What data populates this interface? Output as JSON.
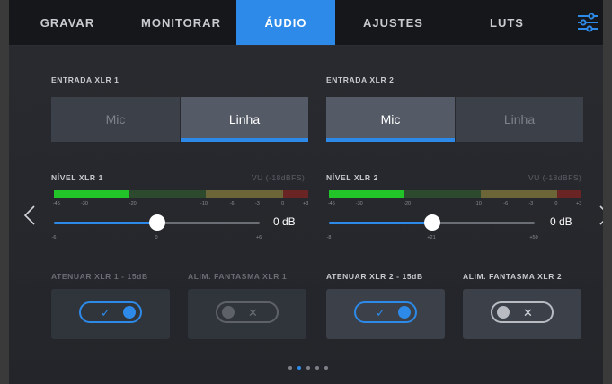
{
  "tabs": [
    {
      "label": "GRAVAR",
      "active": false
    },
    {
      "label": "MONITORAR",
      "active": false
    },
    {
      "label": "ÁUDIO",
      "active": true
    },
    {
      "label": "AJUSTES",
      "active": false
    },
    {
      "label": "LUTS",
      "active": false
    }
  ],
  "channel1": {
    "input_label": "ENTRADA XLR 1",
    "input_options": [
      "Mic",
      "Linha"
    ],
    "input_selected": "Linha",
    "level_label": "NÍVEL XLR 1",
    "vu_label": "VU (-18dBFS)",
    "meter_ticks": [
      "-45",
      "-30",
      "-20",
      "-10",
      "-6",
      "-3",
      "0",
      "+3"
    ],
    "gain_value": "0 dB",
    "gain_fraction": 0.5,
    "scale": [
      "-6",
      "0",
      "+6"
    ],
    "attenuate_label": "ATENUAR XLR 1 - 15dB",
    "attenuate_on": true,
    "phantom_label": "ALIM. FANTASMA XLR 1",
    "phantom_on": false
  },
  "channel2": {
    "input_label": "ENTRADA XLR 2",
    "input_options": [
      "Mic",
      "Linha"
    ],
    "input_selected": "Mic",
    "level_label": "NÍVEL XLR 2",
    "vu_label": "VU (-18dBFS)",
    "meter_ticks": [
      "-45",
      "-30",
      "-20",
      "-10",
      "-6",
      "-3",
      "0",
      "+3"
    ],
    "gain_value": "0 dB",
    "gain_fraction": 0.5,
    "scale": [
      "-8",
      "+21",
      "+50"
    ],
    "attenuate_label": "ATENUAR XLR 2 - 15dB",
    "attenuate_on": true,
    "phantom_label": "ALIM. FANTASMA XLR 2",
    "phantom_on": false
  },
  "toggle_marks": {
    "on": "✓",
    "off": "✕"
  },
  "pager": {
    "count": 5,
    "active": 1
  },
  "colors": {
    "accent": "#2d8ae8",
    "meter_green": "#22c42a",
    "meter_dark_green": "#2e4a2e",
    "meter_olive": "#6b6538",
    "meter_red": "#6b2424"
  }
}
